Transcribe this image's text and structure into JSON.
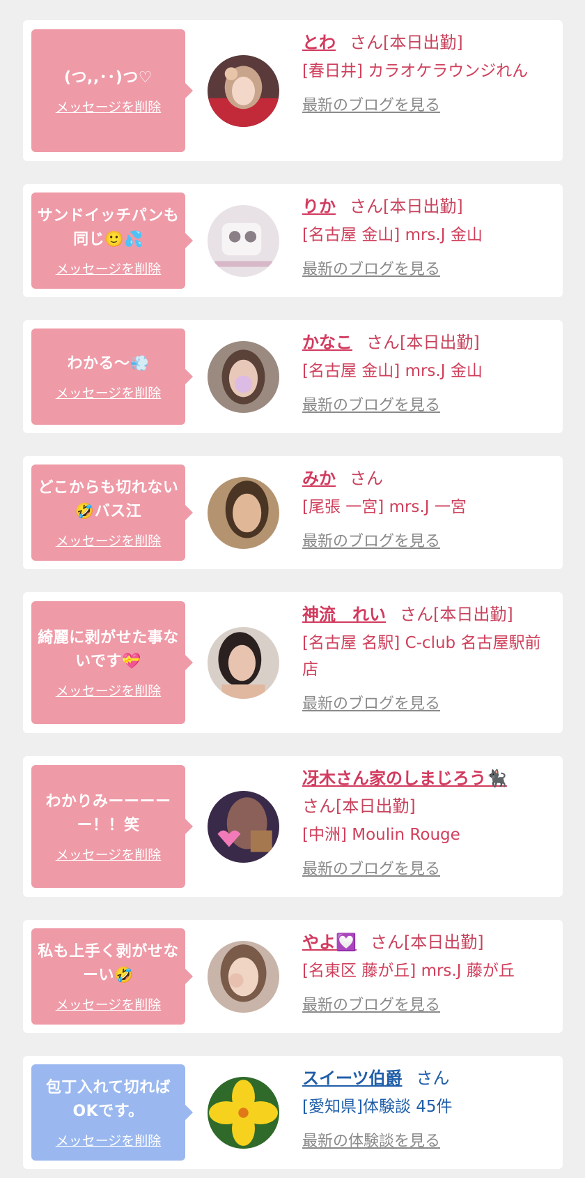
{
  "items": [
    {
      "message": "(つ,,･･)つ♡",
      "delete_label": "メッセージを削除",
      "name": "とわ",
      "san": "さん[本日出勤]",
      "shop": "[春日井] カラオケラウンジれん",
      "blog": "最新のブログを見る"
    },
    {
      "message": "サンドイッチパンも同じ🙂💦",
      "delete_label": "メッセージを削除",
      "name": "りか",
      "san": "さん[本日出勤]",
      "shop": "[名古屋 金山] mrs.J 金山",
      "blog": "最新のブログを見る"
    },
    {
      "message": "わかる〜💨",
      "delete_label": "メッセージを削除",
      "name": "かなこ",
      "san": "さん[本日出勤]",
      "shop": "[名古屋 金山] mrs.J 金山",
      "blog": "最新のブログを見る"
    },
    {
      "message": "どこからも切れない🤣バス江",
      "delete_label": "メッセージを削除",
      "name": "みか",
      "san": "さん",
      "shop": "[尾張 一宮] mrs.J 一宮",
      "blog": "最新のブログを見る"
    },
    {
      "message": "綺麗に剥がせた事ないです💝",
      "delete_label": "メッセージを削除",
      "name": "神流　れい",
      "san": "さん[本日出勤]",
      "shop": "[名古屋 名駅] C-club 名古屋駅前店",
      "blog": "最新のブログを見る"
    },
    {
      "message": "わかりみーーーーー！！笑",
      "delete_label": "メッセージを削除",
      "name": "冴木さん家のしまじろう🐈‍⬛",
      "san": "さん[本日出勤]",
      "shop": "[中洲] Moulin Rouge",
      "blog": "最新のブログを見る"
    },
    {
      "message": "私も上手く剥がせなーい🤣",
      "delete_label": "メッセージを削除",
      "name": "やよ💟",
      "san": "さん[本日出勤]",
      "shop": "[名東区 藤が丘] mrs.J 藤が丘",
      "blog": "最新のブログを見る"
    },
    {
      "message": "包丁入れて切ればOKです。",
      "delete_label": "メッセージを削除",
      "name": "スイーツ伯爵",
      "san": "さん",
      "shop": "[愛知県]体験談 45件",
      "blog": "最新の体験談を見る"
    }
  ],
  "colors": {
    "bubble_pink": "#ef9aa7",
    "bubble_blue": "#9ab8ef",
    "name_pink": "#d23a5e",
    "name_blue": "#1f5ea8",
    "link_gray": "#8a8a8a"
  }
}
